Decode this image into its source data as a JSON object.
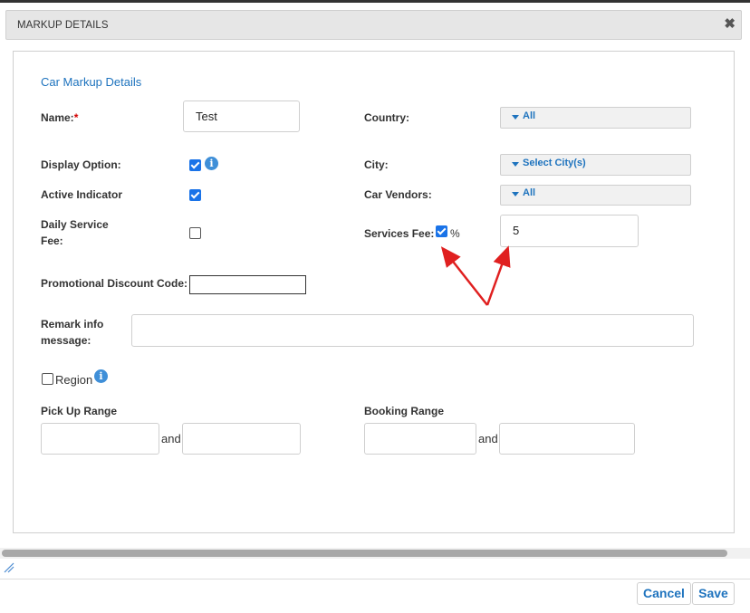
{
  "dialog": {
    "title": "MARKUP DETAILS",
    "close_label": "✖"
  },
  "section_title": "Car Markup Details",
  "left_fields": {
    "name_label": "Name:",
    "name_required": "*",
    "name_value": "Test",
    "display_option_label": "Display Option:",
    "display_option_checked": true,
    "active_indicator_label": "Active Indicator",
    "active_indicator_checked": true,
    "daily_service_fee_label_line1": "Daily Service",
    "daily_service_fee_label_line2": "Fee:",
    "daily_service_fee_checked": false,
    "promo_code_label": "Promotional Discount Code:",
    "promo_code_value": "",
    "remark_label_line1": "Remark info",
    "remark_label_line2": "message:",
    "remark_value": ""
  },
  "right_fields": {
    "country_label": "Country:",
    "country_value": "All",
    "city_label": "City:",
    "city_value": "Select City(s)",
    "vendors_label": "Car Vendors:",
    "vendors_value": "All",
    "services_fee_label": "Services Fee:",
    "services_fee_percent_checked": true,
    "percent_symbol": "%",
    "services_fee_value": "5"
  },
  "region": {
    "label": "Region",
    "checked": false
  },
  "ranges": {
    "pickup_label": "Pick Up Range",
    "booking_label": "Booking Range",
    "and_text": "and",
    "pickup_from": "",
    "pickup_to": "",
    "booking_from": "",
    "booking_to": ""
  },
  "footer": {
    "cancel_label": "Cancel",
    "save_label": "Save"
  },
  "icons": {
    "info": "info-icon",
    "dropdown": "caret-down-icon",
    "close": "close-icon",
    "resize": "resize-grip-icon"
  },
  "colors": {
    "accent": "#1e73be",
    "checkbox": "#1a73e8",
    "annotation_arrow": "#e02020",
    "required": "#d40000"
  }
}
